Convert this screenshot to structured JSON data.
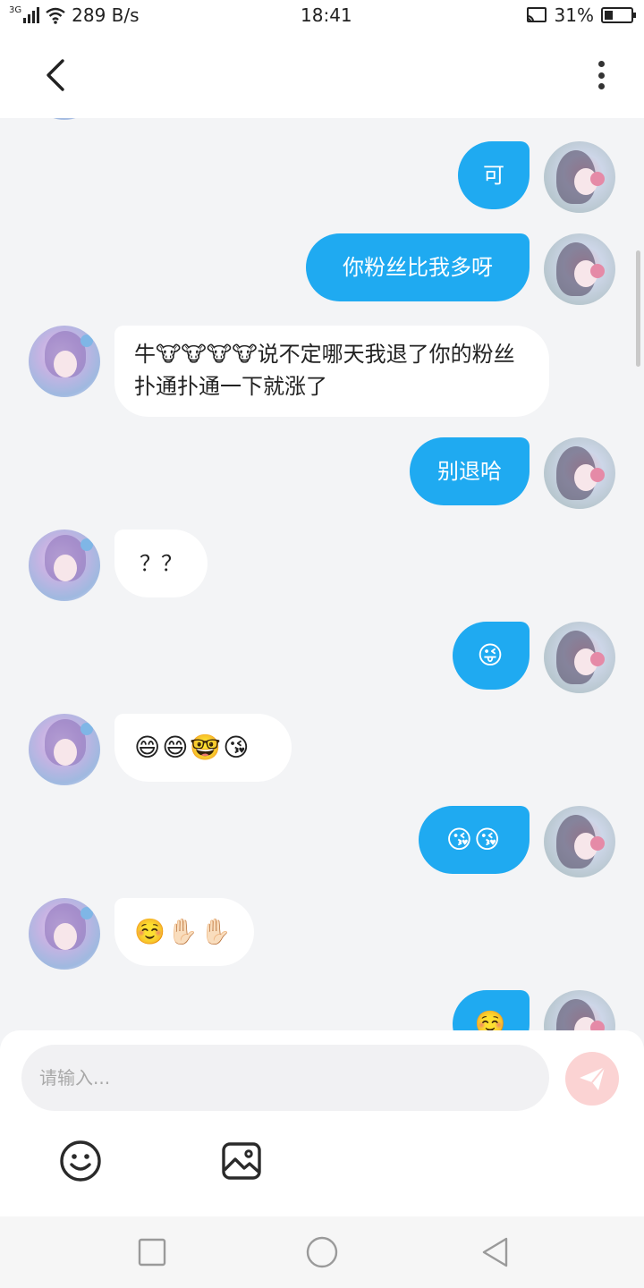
{
  "status_bar": {
    "network": "3G",
    "speed": "289 B/s",
    "time": "18:41",
    "battery": "31%",
    "battery_level": 0.31
  },
  "header": {
    "back_icon": "chevron-left-icon",
    "more_icon": "more-vertical-icon"
  },
  "messages": [
    {
      "from": "me",
      "text": "可"
    },
    {
      "from": "me",
      "text": "你粉丝比我多呀"
    },
    {
      "from": "other",
      "text": "牛🐮🐮🐮🐮说不定哪天我退了你的粉丝扑通扑通一下就涨了"
    },
    {
      "from": "me",
      "text": "别退哈"
    },
    {
      "from": "other",
      "text": "？？"
    },
    {
      "from": "me",
      "text": "😜"
    },
    {
      "from": "other",
      "text": "😄😄🤓😘"
    },
    {
      "from": "me",
      "text": "😘😘"
    },
    {
      "from": "other",
      "text": "☺️✋🏻✋🏻"
    },
    {
      "from": "me",
      "text": "☺️"
    }
  ],
  "composer": {
    "placeholder": "请输入...",
    "send_icon": "send-icon",
    "emoji_icon": "smiley-icon",
    "image_icon": "image-icon"
  },
  "nav": {
    "recent_icon": "square-icon",
    "home_icon": "circle-icon",
    "back_icon": "triangle-back-icon"
  },
  "colors": {
    "bubble_me": "#1faaf1",
    "bubble_other": "#ffffff",
    "background": "#f3f4f6",
    "send_disabled": "#fbd3d3"
  }
}
